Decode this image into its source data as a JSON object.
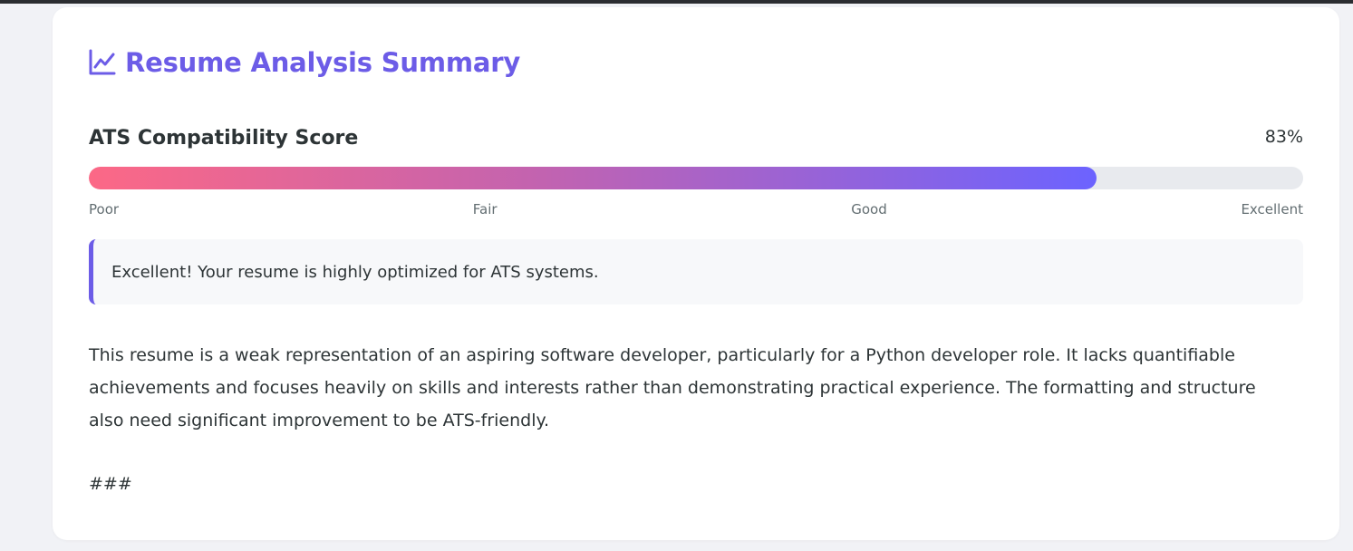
{
  "card": {
    "title": "Resume Analysis Summary",
    "icon": "line-chart-icon",
    "accent_color": "#6c5ce7"
  },
  "ats": {
    "label": "ATS Compatibility Score",
    "score_text": "83%",
    "score": 83,
    "scale": [
      "Poor",
      "Fair",
      "Good",
      "Excellent"
    ],
    "gradient": [
      "#fc6886",
      "#6c63ff"
    ]
  },
  "notice": {
    "text": "Excellent! Your resume is highly optimized for ATS systems."
  },
  "summary": {
    "text": "This resume is a weak representation of an aspiring software developer, particularly for a Python developer role. It lacks quantifiable achievements and focuses heavily on skills and interests rather than demonstrating practical experience. The formatting and structure also need significant improvement to be ATS-friendly.",
    "section_mark": "###"
  }
}
